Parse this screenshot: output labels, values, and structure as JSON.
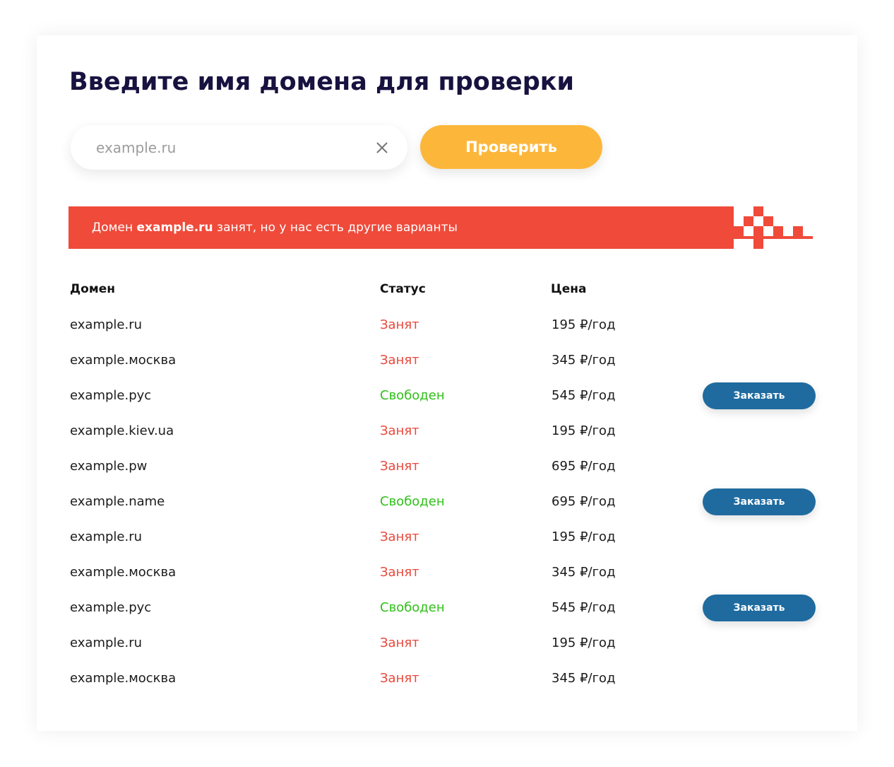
{
  "colors": {
    "title": "#17123f",
    "accent_yellow": "#fcb73b",
    "banner_red": "#ef4a3a",
    "status_busy": "#e9483b",
    "status_free": "#2fc018",
    "order_button": "#1f6b9f"
  },
  "header": {
    "title": "Введите имя домена для проверки"
  },
  "search": {
    "placeholder": "example.ru",
    "value": "",
    "clear_icon": "close-icon",
    "submit_label": "Проверить"
  },
  "banner": {
    "prefix": "Домен ",
    "domain": "example.ru",
    "suffix": " занят, но у нас есть другие варианты"
  },
  "table": {
    "columns": [
      "Домен",
      "Статус",
      "Цена"
    ],
    "rows": [
      {
        "domain": "example.ru",
        "status": "Занят",
        "available": false,
        "price": "195 ₽/год"
      },
      {
        "domain": "example.москва",
        "status": "Занят",
        "available": false,
        "price": "345 ₽/год"
      },
      {
        "domain": "example.рус",
        "status": "Свободен",
        "available": true,
        "price": "545 ₽/год",
        "action": "Заказать"
      },
      {
        "domain": "example.kiev.ua",
        "status": "Занят",
        "available": false,
        "price": "195 ₽/год"
      },
      {
        "domain": "example.pw",
        "status": "Занят",
        "available": false,
        "price": "695 ₽/год"
      },
      {
        "domain": "example.name",
        "status": "Свободен",
        "available": true,
        "price": "695 ₽/год",
        "action": "Заказать"
      },
      {
        "domain": "example.ru",
        "status": "Занят",
        "available": false,
        "price": "195 ₽/год"
      },
      {
        "domain": "example.москва",
        "status": "Занят",
        "available": false,
        "price": "345 ₽/год"
      },
      {
        "domain": "example.рус",
        "status": "Свободен",
        "available": true,
        "price": "545 ₽/год",
        "action": "Заказать"
      },
      {
        "domain": "example.ru",
        "status": "Занят",
        "available": false,
        "price": "195 ₽/год"
      },
      {
        "domain": "example.москва",
        "status": "Занят",
        "available": false,
        "price": "345 ₽/год"
      }
    ]
  }
}
